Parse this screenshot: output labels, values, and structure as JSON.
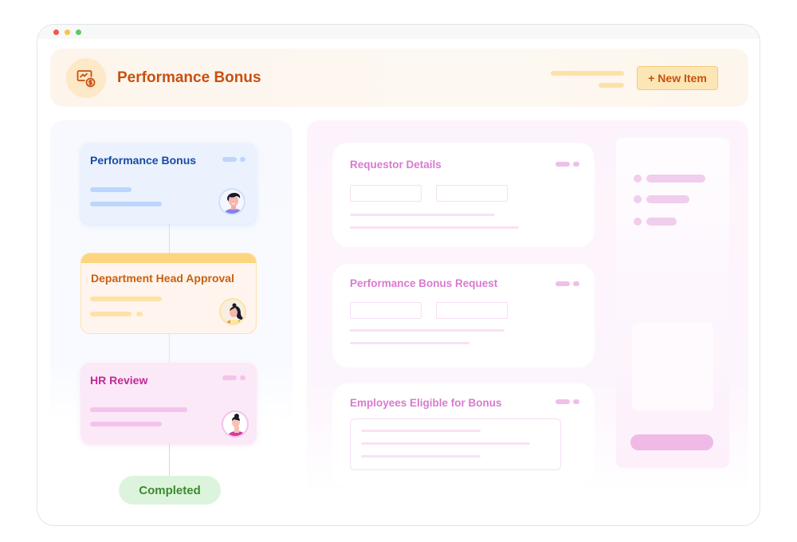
{
  "window": {
    "controls": [
      "close",
      "minimize",
      "maximize"
    ]
  },
  "header": {
    "icon": "chart-dollar-icon",
    "title": "Performance Bonus",
    "new_item_label": "+ New Item"
  },
  "workflow": {
    "steps": [
      {
        "title": "Performance Bonus",
        "theme": "blue",
        "accent": "#1a4aa5",
        "avatar": "person-avatar"
      },
      {
        "title": "Department Head Approval",
        "theme": "orange",
        "accent": "#c8600f",
        "avatar": "person-avatar"
      },
      {
        "title": "HR Review",
        "theme": "pink",
        "accent": "#c02a96",
        "avatar": "person-avatar"
      }
    ],
    "end_status": "Completed"
  },
  "form": {
    "sections": [
      {
        "title": "Requestor Details"
      },
      {
        "title": "Performance Bonus Request"
      },
      {
        "title": "Employees Eligible for Bonus"
      }
    ]
  },
  "colors": {
    "brand_orange": "#c8500f",
    "flow_blue": "#1a4aa5",
    "flow_pink": "#c02a96",
    "completed_green": "#3c8a2e",
    "form_title_pink": "#d87ad0"
  }
}
